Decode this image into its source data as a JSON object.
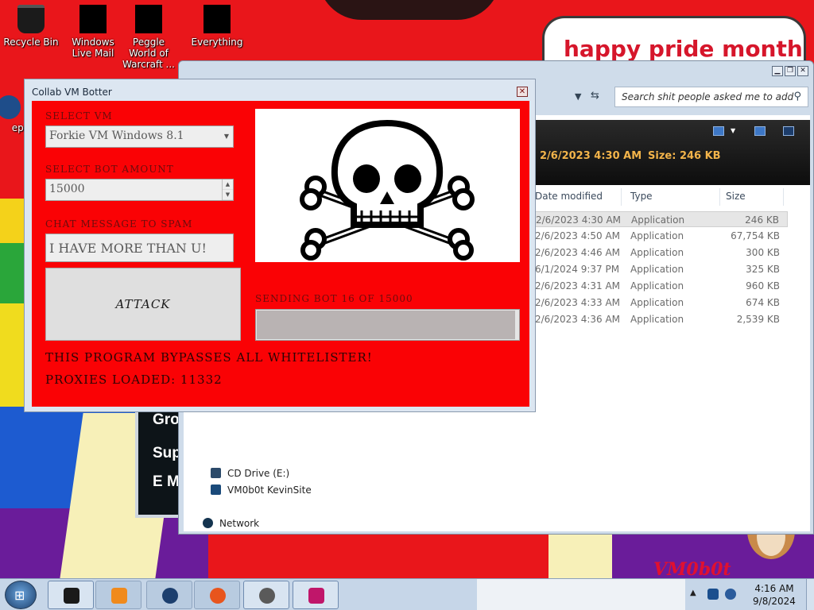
{
  "desktop": {
    "banner_text": "happy pride month",
    "icons": [
      {
        "label": "Recycle Bin"
      },
      {
        "label": "Windows Live Mail"
      },
      {
        "label": "Peggle World of Warcraft ..."
      },
      {
        "label": "Everything"
      }
    ],
    "left_partial_label": "epe",
    "side_card": [
      "Gro",
      "Sup",
      "E M"
    ],
    "watermark": "VM0b0t"
  },
  "explorer": {
    "search_placeholder": "Search shit people asked me to add",
    "details": {
      "date": "2/6/2023 4:30 AM",
      "size_label": "Size:",
      "size_value": "246 KB"
    },
    "columns": [
      "Date modified",
      "Type",
      "Size"
    ],
    "rows": [
      {
        "date": "2/6/2023 4:30 AM",
        "type": "Application",
        "size": "246 KB",
        "selected": true
      },
      {
        "date": "2/6/2023 4:50 AM",
        "type": "Application",
        "size": "67,754 KB"
      },
      {
        "date": "2/6/2023 4:46 AM",
        "type": "Application",
        "size": "300 KB"
      },
      {
        "date": "6/1/2024 9:37 PM",
        "type": "Application",
        "size": "325 KB"
      },
      {
        "date": "2/6/2023 4:31 AM",
        "type": "Application",
        "size": "960 KB"
      },
      {
        "date": "2/6/2023 4:33 AM",
        "type": "Application",
        "size": "674 KB"
      },
      {
        "date": "2/6/2023 4:36 AM",
        "type": "Application",
        "size": "2,539 KB"
      }
    ],
    "nav": [
      {
        "label": "CD Drive (E:)"
      },
      {
        "label": "VM0b0t KevinSite"
      },
      {
        "label": "Network"
      }
    ]
  },
  "bot": {
    "title": "Collab VM Botter",
    "select_vm_label": "SELECT VM",
    "selected_vm": "Forkie VM Windows 8.1",
    "bot_amount_label": "SELECT BOT AMOUNT",
    "bot_amount": "15000",
    "chat_label": "CHAT MESSAGE TO SPAM",
    "chat_message": "I HAVE MORE THAN U!",
    "attack_label": "ATTACK",
    "progress_label": "SENDING BOT 16 OF 15000",
    "progress_fraction": 0.001,
    "status_1": "THIS PROGRAM BYPASSES ALL WHITELISTER!",
    "status_2": "PROXIES LOADED: 11332"
  },
  "taskbar": {
    "time": "4:16 AM",
    "date": "9/8/2024",
    "apps": [
      {
        "name": "cmd-icon",
        "color": "#1a1a1a"
      },
      {
        "name": "media-player-icon",
        "color": "#f08a1c"
      },
      {
        "name": "globe-icon",
        "color": "#1c3f6e"
      },
      {
        "name": "firefox-icon",
        "color": "#e8551d"
      },
      {
        "name": "skull-app-icon",
        "color": "#5a5a5a"
      },
      {
        "name": "paint-app-icon",
        "color": "#c0166a"
      }
    ]
  },
  "colors": {
    "bot_red": "#fa0205",
    "wallpaper_red": "#e9161b",
    "banner_red": "#d6162b"
  }
}
